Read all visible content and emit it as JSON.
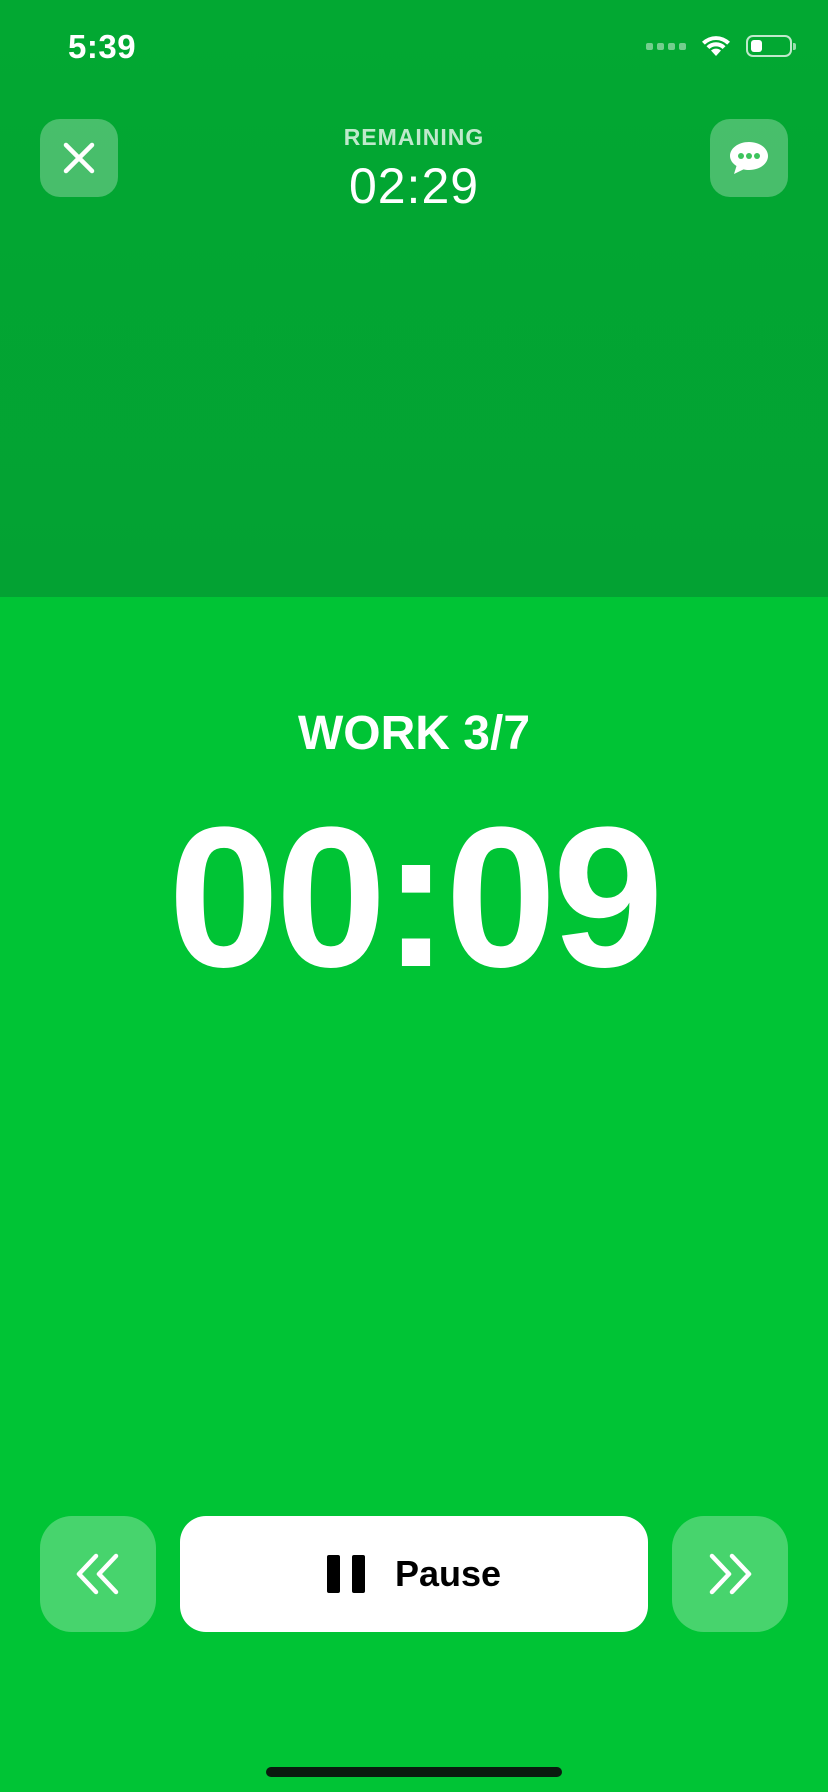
{
  "status_bar": {
    "time": "5:39",
    "battery_level": 0.3
  },
  "header": {
    "remaining_label": "REMAINING",
    "remaining_time": "02:29"
  },
  "timer": {
    "phase_label": "WORK 3/7",
    "time": "00:09"
  },
  "controls": {
    "pause_label": "Pause"
  },
  "colors": {
    "top_background": "#03a533",
    "main_background": "#00c435",
    "button_overlay": "rgba(255,255,255,0.28)",
    "pause_button": "#ffffff"
  },
  "icons": {
    "close": "close-icon",
    "chat": "chat-bubble-icon",
    "previous": "double-chevron-left-icon",
    "next": "double-chevron-right-icon",
    "pause": "pause-icon",
    "wifi": "wifi-icon",
    "signal": "cellular-signal-icon",
    "battery": "battery-icon"
  }
}
